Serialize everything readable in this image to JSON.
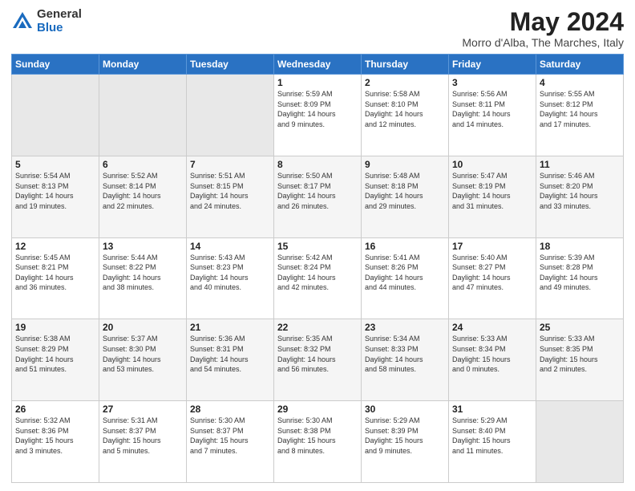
{
  "header": {
    "logo_general": "General",
    "logo_blue": "Blue",
    "title": "May 2024",
    "location": "Morro d'Alba, The Marches, Italy"
  },
  "days_of_week": [
    "Sunday",
    "Monday",
    "Tuesday",
    "Wednesday",
    "Thursday",
    "Friday",
    "Saturday"
  ],
  "weeks": [
    [
      {
        "day": "",
        "info": ""
      },
      {
        "day": "",
        "info": ""
      },
      {
        "day": "",
        "info": ""
      },
      {
        "day": "1",
        "info": "Sunrise: 5:59 AM\nSunset: 8:09 PM\nDaylight: 14 hours\nand 9 minutes."
      },
      {
        "day": "2",
        "info": "Sunrise: 5:58 AM\nSunset: 8:10 PM\nDaylight: 14 hours\nand 12 minutes."
      },
      {
        "day": "3",
        "info": "Sunrise: 5:56 AM\nSunset: 8:11 PM\nDaylight: 14 hours\nand 14 minutes."
      },
      {
        "day": "4",
        "info": "Sunrise: 5:55 AM\nSunset: 8:12 PM\nDaylight: 14 hours\nand 17 minutes."
      }
    ],
    [
      {
        "day": "5",
        "info": "Sunrise: 5:54 AM\nSunset: 8:13 PM\nDaylight: 14 hours\nand 19 minutes."
      },
      {
        "day": "6",
        "info": "Sunrise: 5:52 AM\nSunset: 8:14 PM\nDaylight: 14 hours\nand 22 minutes."
      },
      {
        "day": "7",
        "info": "Sunrise: 5:51 AM\nSunset: 8:15 PM\nDaylight: 14 hours\nand 24 minutes."
      },
      {
        "day": "8",
        "info": "Sunrise: 5:50 AM\nSunset: 8:17 PM\nDaylight: 14 hours\nand 26 minutes."
      },
      {
        "day": "9",
        "info": "Sunrise: 5:48 AM\nSunset: 8:18 PM\nDaylight: 14 hours\nand 29 minutes."
      },
      {
        "day": "10",
        "info": "Sunrise: 5:47 AM\nSunset: 8:19 PM\nDaylight: 14 hours\nand 31 minutes."
      },
      {
        "day": "11",
        "info": "Sunrise: 5:46 AM\nSunset: 8:20 PM\nDaylight: 14 hours\nand 33 minutes."
      }
    ],
    [
      {
        "day": "12",
        "info": "Sunrise: 5:45 AM\nSunset: 8:21 PM\nDaylight: 14 hours\nand 36 minutes."
      },
      {
        "day": "13",
        "info": "Sunrise: 5:44 AM\nSunset: 8:22 PM\nDaylight: 14 hours\nand 38 minutes."
      },
      {
        "day": "14",
        "info": "Sunrise: 5:43 AM\nSunset: 8:23 PM\nDaylight: 14 hours\nand 40 minutes."
      },
      {
        "day": "15",
        "info": "Sunrise: 5:42 AM\nSunset: 8:24 PM\nDaylight: 14 hours\nand 42 minutes."
      },
      {
        "day": "16",
        "info": "Sunrise: 5:41 AM\nSunset: 8:26 PM\nDaylight: 14 hours\nand 44 minutes."
      },
      {
        "day": "17",
        "info": "Sunrise: 5:40 AM\nSunset: 8:27 PM\nDaylight: 14 hours\nand 47 minutes."
      },
      {
        "day": "18",
        "info": "Sunrise: 5:39 AM\nSunset: 8:28 PM\nDaylight: 14 hours\nand 49 minutes."
      }
    ],
    [
      {
        "day": "19",
        "info": "Sunrise: 5:38 AM\nSunset: 8:29 PM\nDaylight: 14 hours\nand 51 minutes."
      },
      {
        "day": "20",
        "info": "Sunrise: 5:37 AM\nSunset: 8:30 PM\nDaylight: 14 hours\nand 53 minutes."
      },
      {
        "day": "21",
        "info": "Sunrise: 5:36 AM\nSunset: 8:31 PM\nDaylight: 14 hours\nand 54 minutes."
      },
      {
        "day": "22",
        "info": "Sunrise: 5:35 AM\nSunset: 8:32 PM\nDaylight: 14 hours\nand 56 minutes."
      },
      {
        "day": "23",
        "info": "Sunrise: 5:34 AM\nSunset: 8:33 PM\nDaylight: 14 hours\nand 58 minutes."
      },
      {
        "day": "24",
        "info": "Sunrise: 5:33 AM\nSunset: 8:34 PM\nDaylight: 15 hours\nand 0 minutes."
      },
      {
        "day": "25",
        "info": "Sunrise: 5:33 AM\nSunset: 8:35 PM\nDaylight: 15 hours\nand 2 minutes."
      }
    ],
    [
      {
        "day": "26",
        "info": "Sunrise: 5:32 AM\nSunset: 8:36 PM\nDaylight: 15 hours\nand 3 minutes."
      },
      {
        "day": "27",
        "info": "Sunrise: 5:31 AM\nSunset: 8:37 PM\nDaylight: 15 hours\nand 5 minutes."
      },
      {
        "day": "28",
        "info": "Sunrise: 5:30 AM\nSunset: 8:37 PM\nDaylight: 15 hours\nand 7 minutes."
      },
      {
        "day": "29",
        "info": "Sunrise: 5:30 AM\nSunset: 8:38 PM\nDaylight: 15 hours\nand 8 minutes."
      },
      {
        "day": "30",
        "info": "Sunrise: 5:29 AM\nSunset: 8:39 PM\nDaylight: 15 hours\nand 9 minutes."
      },
      {
        "day": "31",
        "info": "Sunrise: 5:29 AM\nSunset: 8:40 PM\nDaylight: 15 hours\nand 11 minutes."
      },
      {
        "day": "",
        "info": ""
      }
    ]
  ]
}
